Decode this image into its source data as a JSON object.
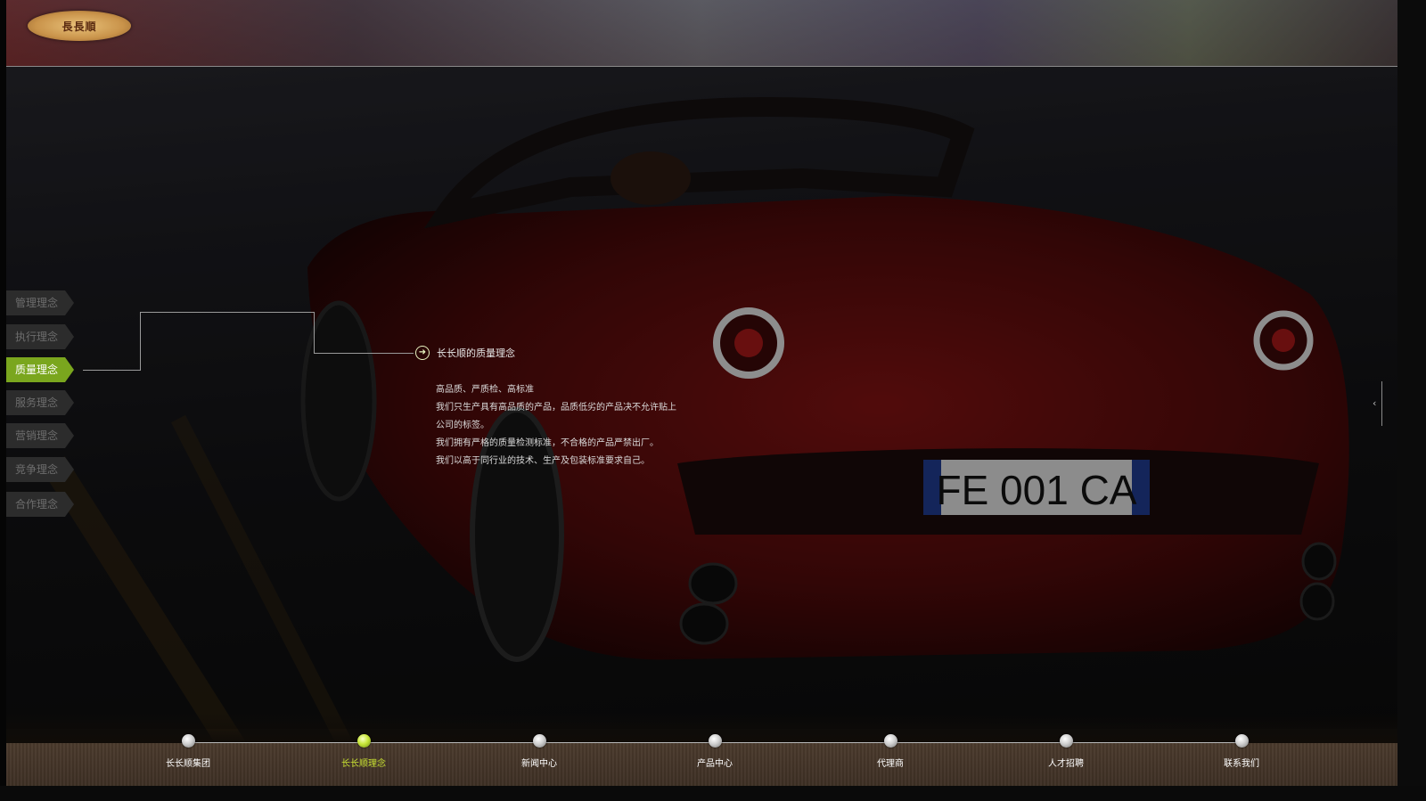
{
  "header": {
    "logo_text": "長長順"
  },
  "side_menu": {
    "items": [
      {
        "label": "管理理念",
        "active": false
      },
      {
        "label": "执行理念",
        "active": false
      },
      {
        "label": "质量理念",
        "active": true
      },
      {
        "label": "服务理念",
        "active": false
      },
      {
        "label": "营销理念",
        "active": false
      },
      {
        "label": "竞争理念",
        "active": false
      },
      {
        "label": "合作理念",
        "active": false
      }
    ]
  },
  "content": {
    "title": "长长顺的质量理念",
    "lines": [
      "高品质、严质检、高标准",
      "我们只生产具有高品质的产品，品质低劣的产品决不允许贴上",
      "公司的标签。",
      "我们拥有严格的质量检测标准，不合格的产品严禁出厂。",
      "我们以高于同行业的技术、生产及包装标准要求自己。"
    ]
  },
  "background": {
    "plate_text": "FE 001 CA"
  },
  "edge_toggle": {
    "glyph": "‹"
  },
  "bottom_nav": {
    "items": [
      {
        "label": "长长顺集团",
        "active": false
      },
      {
        "label": "长长顺理念",
        "active": true
      },
      {
        "label": "新闻中心",
        "active": false
      },
      {
        "label": "产品中心",
        "active": false
      },
      {
        "label": "代理商",
        "active": false
      },
      {
        "label": "人才招聘",
        "active": false
      },
      {
        "label": "联系我们",
        "active": false
      }
    ]
  },
  "colors": {
    "accent": "#7aa61e",
    "active_text": "#c9e232"
  }
}
